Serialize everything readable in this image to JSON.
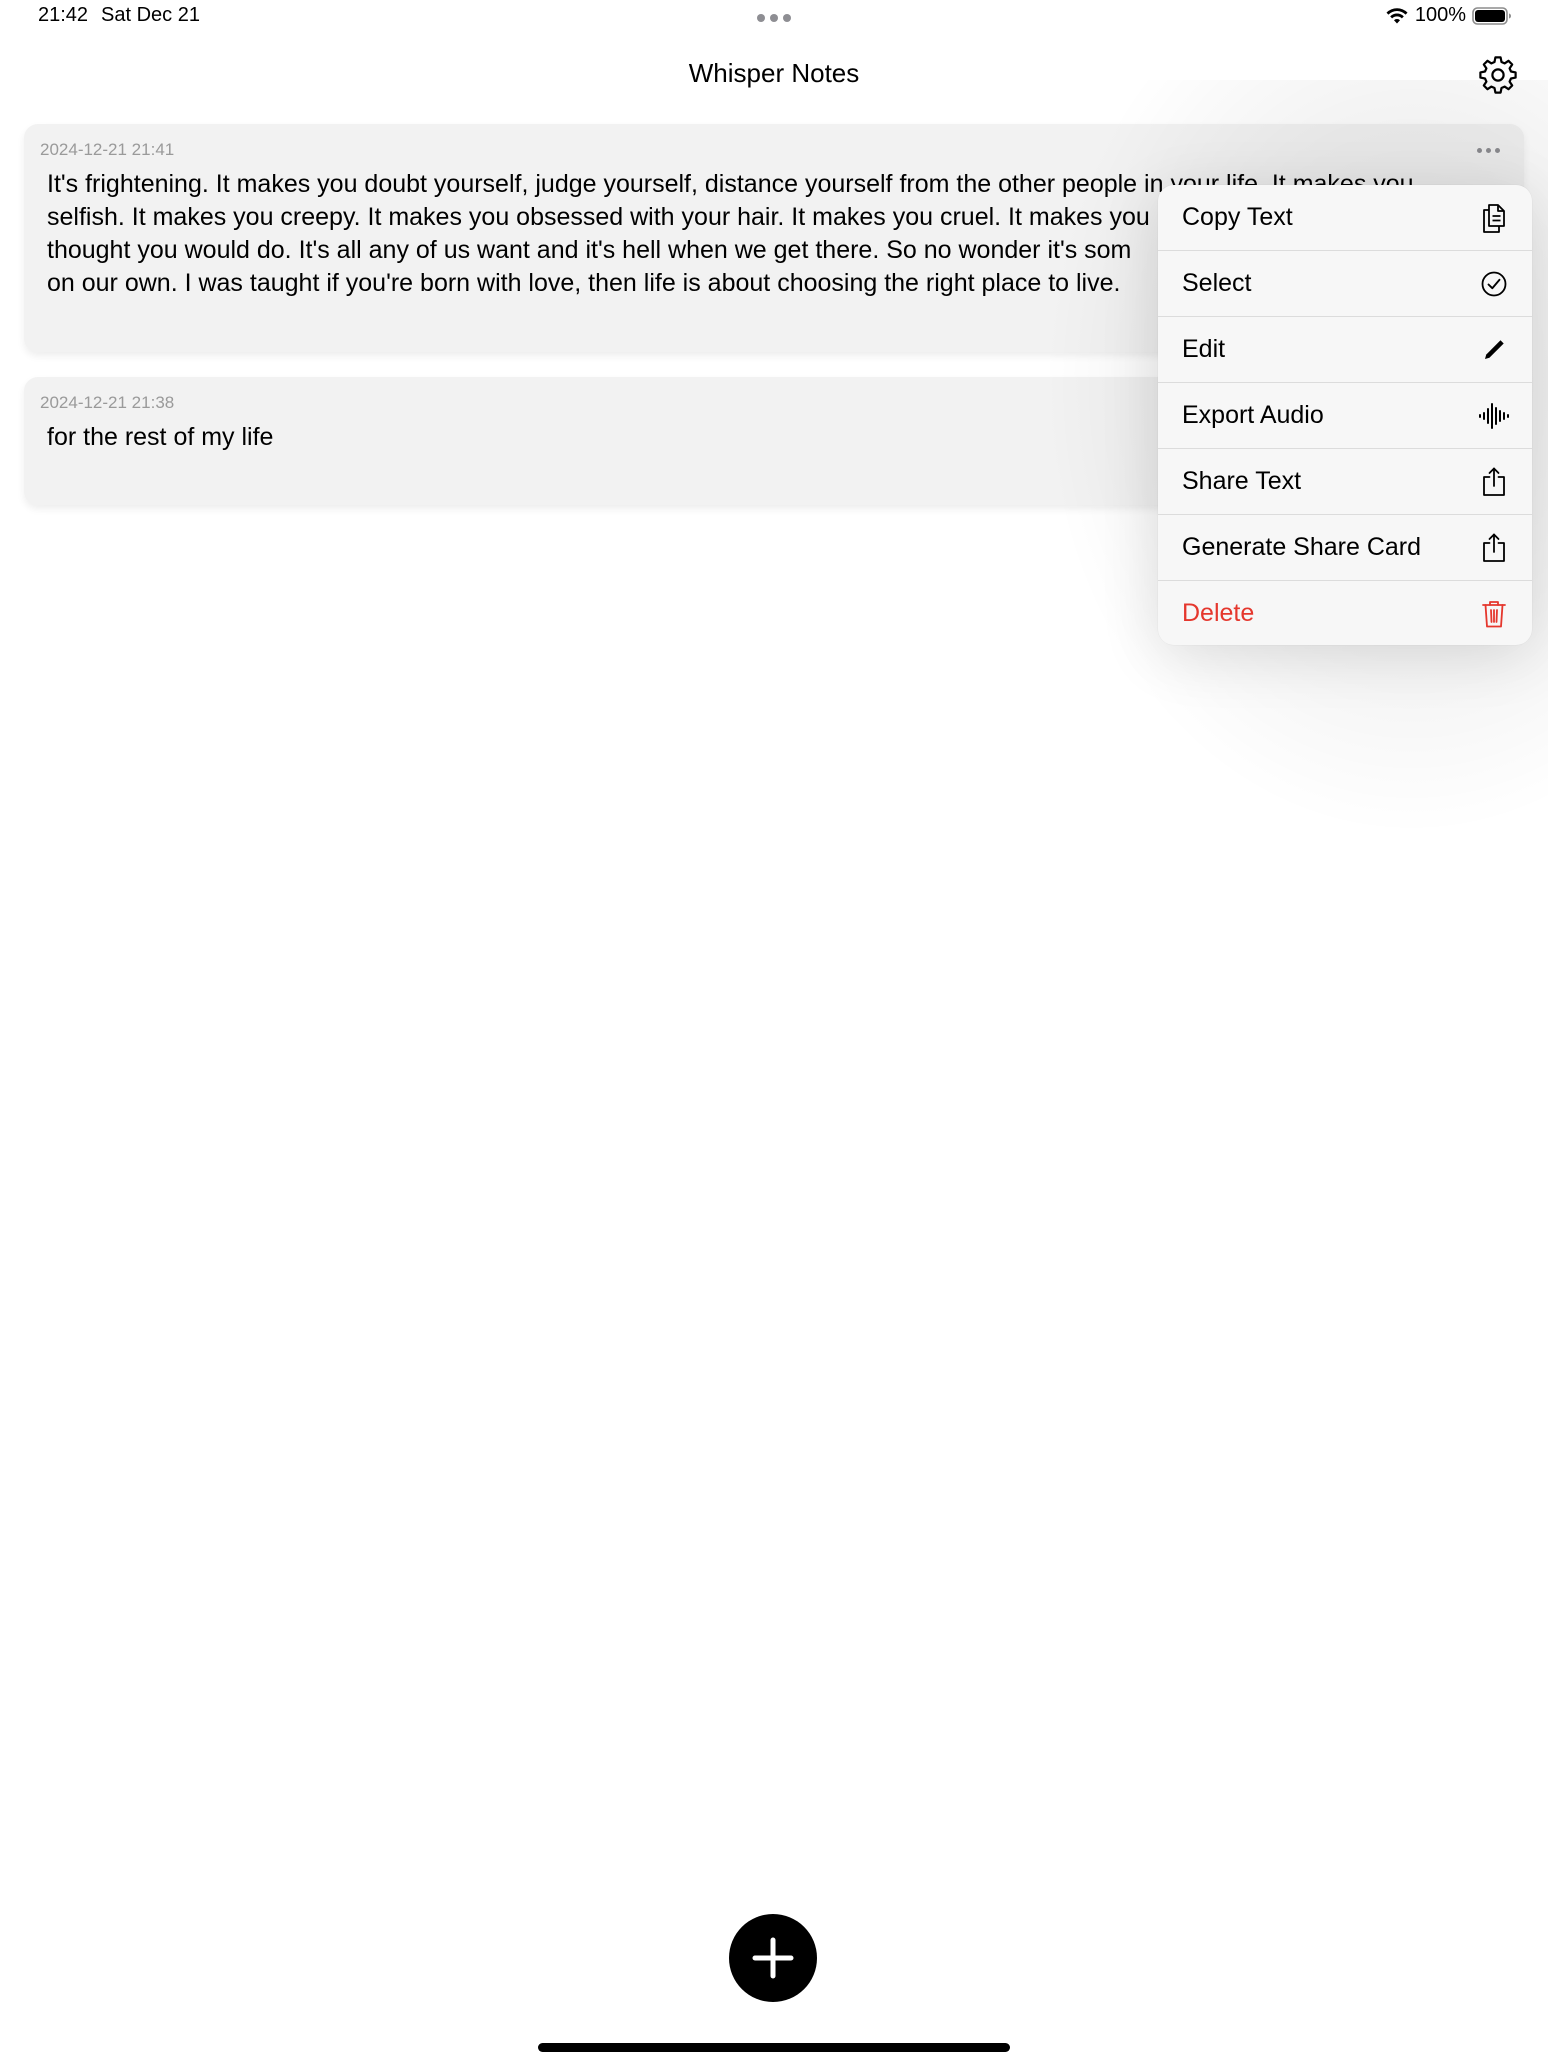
{
  "status_bar": {
    "time": "21:42",
    "date": "Sat Dec 21",
    "battery": "100%"
  },
  "header": {
    "title": "Whisper Notes"
  },
  "notes": [
    {
      "timestamp": "2024-12-21 21:41",
      "text": "It's frightening. It makes you doubt yourself, judge yourself, distance yourself from the other people in your life. It makes you\nselfish. It makes you creepy. It makes you obsessed with your hair. It makes you cruel. It makes you\nthought you would do. It's all any of us want and it's hell when we get there. So no wonder it's som\non our own. I was taught if you're born with love, then life is about choosing the right place to live."
    },
    {
      "timestamp": "2024-12-21 21:38",
      "text": "for the rest of my life"
    }
  ],
  "context_menu": {
    "items": [
      {
        "label": "Copy Text",
        "icon": "copy-icon"
      },
      {
        "label": "Select",
        "icon": "checkmark-circle-icon"
      },
      {
        "label": "Edit",
        "icon": "pencil-icon"
      },
      {
        "label": "Export Audio",
        "icon": "waveform-icon"
      },
      {
        "label": "Share Text",
        "icon": "share-icon"
      },
      {
        "label": "Generate Share Card",
        "icon": "share-icon"
      },
      {
        "label": "Delete",
        "icon": "trash-icon"
      }
    ],
    "destructive_color": "#e5372d"
  },
  "colors": {
    "card_background": "#f2f2f2",
    "timestamp": "#9a9a9a",
    "fab": "#000000"
  }
}
